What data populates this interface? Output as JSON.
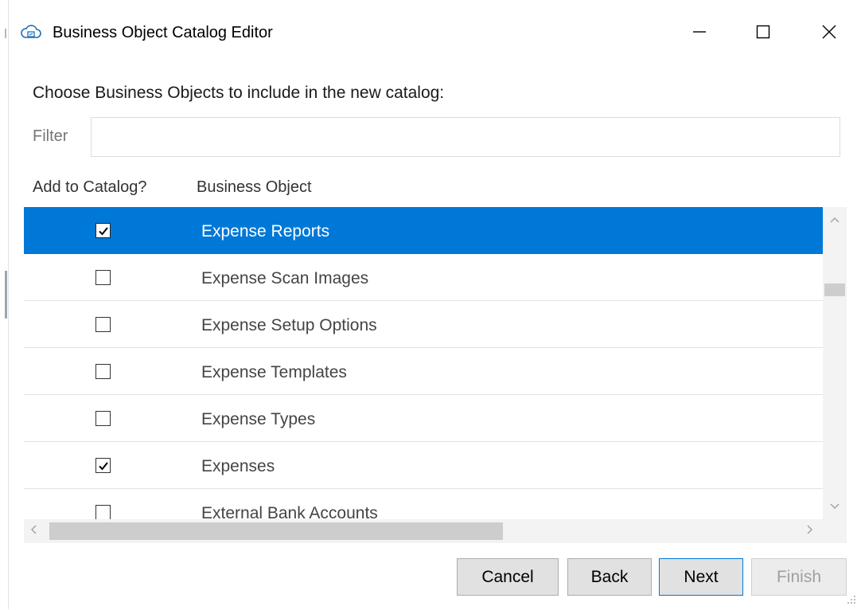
{
  "window": {
    "title": "Business Object Catalog Editor",
    "app_icon": "cloud-icon",
    "controls": [
      "minimize-icon",
      "maximize-icon",
      "close-icon"
    ]
  },
  "prompt": "Choose Business Objects to include in the new catalog:",
  "filter": {
    "label": "Filter",
    "value": "",
    "placeholder": ""
  },
  "columns": {
    "add": "Add to Catalog?",
    "object": "Business Object"
  },
  "rows": [
    {
      "label": "Expense Reports",
      "checked": true,
      "selected": true
    },
    {
      "label": "Expense Scan Images",
      "checked": false,
      "selected": false
    },
    {
      "label": "Expense Setup Options",
      "checked": false,
      "selected": false
    },
    {
      "label": "Expense Templates",
      "checked": false,
      "selected": false
    },
    {
      "label": "Expense Types",
      "checked": false,
      "selected": false
    },
    {
      "label": "Expenses",
      "checked": true,
      "selected": false
    },
    {
      "label": "External Bank Accounts",
      "checked": false,
      "selected": false
    }
  ],
  "buttons": {
    "cancel": "Cancel",
    "back": "Back",
    "next": "Next",
    "finish": "Finish"
  },
  "colors": {
    "selection": "#0078d7",
    "accent": "#0078d7"
  }
}
